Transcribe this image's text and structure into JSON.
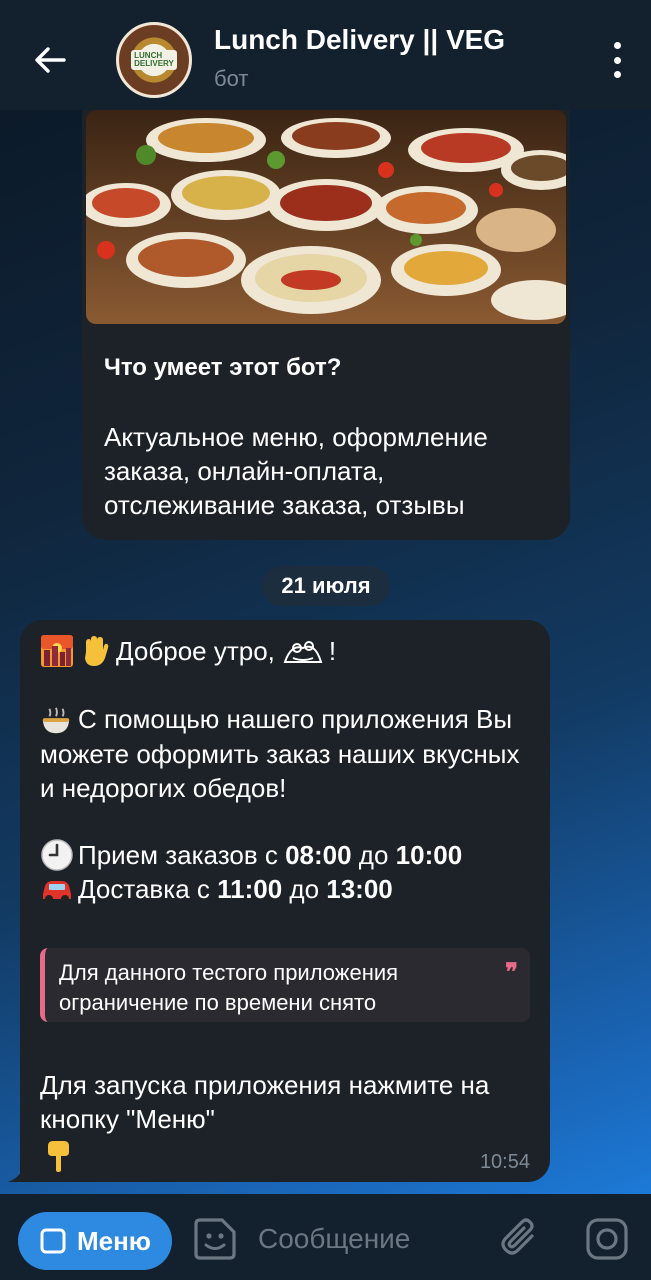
{
  "header": {
    "title": "Lunch Delivery || VEG",
    "subtitle": "бот",
    "avatar_logo": "LUNCH DELIVERY"
  },
  "intro": {
    "heading": "Что умеет этот бот?",
    "text": "Актуальное меню, оформление заказа, онлайн-оплата, отслеживание заказа, отзывы"
  },
  "date_chip": "21 июля",
  "message": {
    "greeting": "Доброе утро,",
    "greeting_end": "!",
    "intro": "С помощью нашего приложения Вы можете оформить заказ наших вкусных и недорогих обедов!",
    "orders_prefix": "Прием заказов с ",
    "orders_from": "08:00",
    "orders_mid": " до ",
    "orders_to": "10:00",
    "delivery_prefix": "Доставка с ",
    "delivery_from": "11:00",
    "delivery_mid": " до ",
    "delivery_to": "13:00",
    "quote": "Для данного тестого приложения ограничение по времени снято",
    "launch": "Для запуска приложения нажмите на кнопку \"Меню\"",
    "time": "10:54"
  },
  "bottom": {
    "menu_label": "Меню",
    "input_placeholder": "Сообщение"
  },
  "colors": {
    "header_bg": "#13202d",
    "bubble_bg": "#1c2228",
    "accent": "#2e8ae0",
    "quote_accent": "#e86a8a",
    "muted": "#7d8a96"
  }
}
